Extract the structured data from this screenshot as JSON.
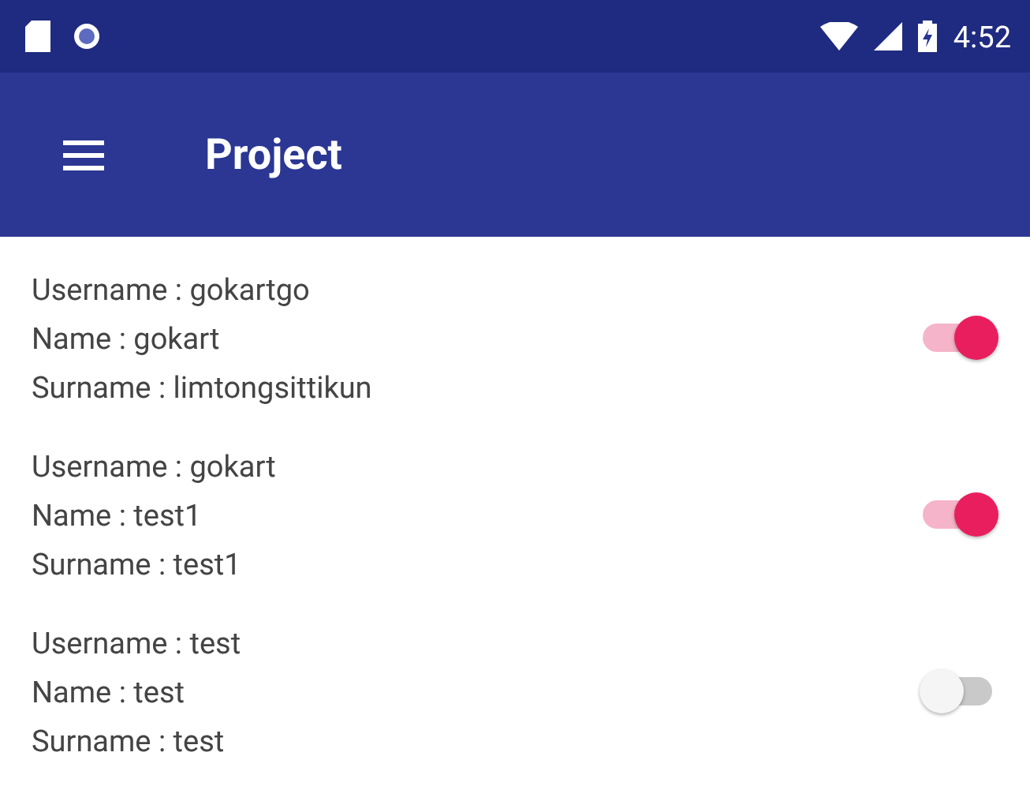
{
  "status_bar": {
    "time": "4:52"
  },
  "app_bar": {
    "title": "Project"
  },
  "users": [
    {
      "lines": [
        "Username : gokartgo",
        "Name : gokart",
        "Surname : limtongsittikun"
      ],
      "on": true
    },
    {
      "lines": [
        "Username : gokart",
        "Name : test1",
        "Surname : test1"
      ],
      "on": true
    },
    {
      "lines": [
        "Username : test",
        "Name : test",
        "Surname : test"
      ],
      "on": false
    }
  ]
}
